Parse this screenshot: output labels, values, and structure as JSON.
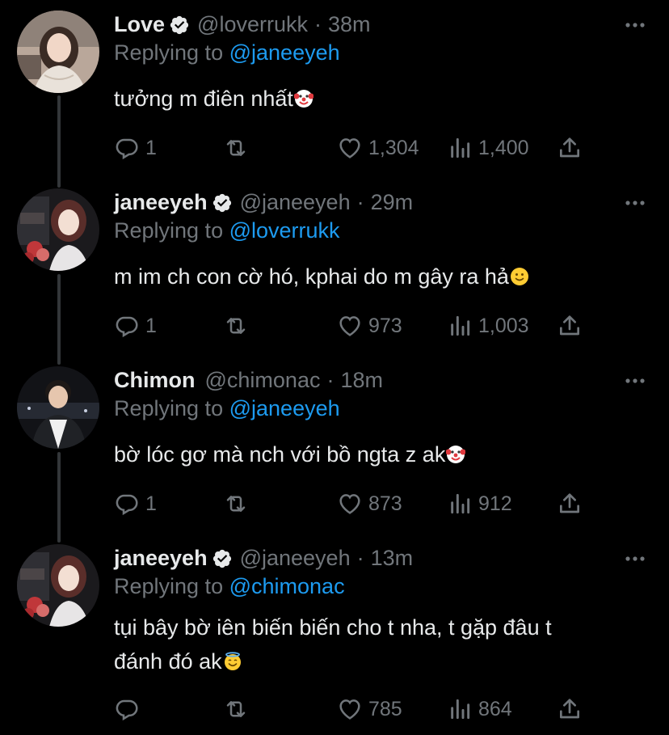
{
  "colors": {
    "background": "#000000",
    "text": "#e7e9ea",
    "muted": "#71767b",
    "link": "#1d9bf0",
    "verified": "#e7e9ea"
  },
  "tweets": [
    {
      "name": "Love",
      "handle": "@loverrukk",
      "time": "38m",
      "replying_prefix": "Replying to",
      "replying_to": "@janeeyeh",
      "lines": [
        "tưởng m điên nhất"
      ],
      "emoji": "clown-face-emoji",
      "replies": "1",
      "likes": "1,304",
      "views": "1,400"
    },
    {
      "name": "janeeyeh",
      "handle": "@janeeyeh",
      "time": "29m",
      "replying_prefix": "Replying to",
      "replying_to": "@loverrukk",
      "lines": [
        "m im ch con cờ hó, kphai do m gây ra hả"
      ],
      "emoji": "slightly-smiling-face-emoji",
      "replies": "1",
      "likes": "973",
      "views": "1,003"
    },
    {
      "name": "Chimon",
      "handle": "@chimonac",
      "time": "18m",
      "replying_prefix": "Replying to",
      "replying_to": "@janeeyeh",
      "lines": [
        "bờ lóc gơ mà nch với bồ ngta z ak"
      ],
      "emoji": "clown-face-emoji",
      "replies": "1",
      "likes": "873",
      "views": "912"
    },
    {
      "name": "janeeyeh",
      "handle": "@janeeyeh",
      "time": "13m",
      "replying_prefix": "Replying to",
      "replying_to": "@chimonac",
      "lines": [
        "tụi bây bờ iên biến biến cho t nha, t gặp đâu t",
        "đánh đó ak"
      ],
      "emoji": "smiling-face-with-halo-emoji",
      "replies": "",
      "likes": "785",
      "views": "864"
    }
  ]
}
